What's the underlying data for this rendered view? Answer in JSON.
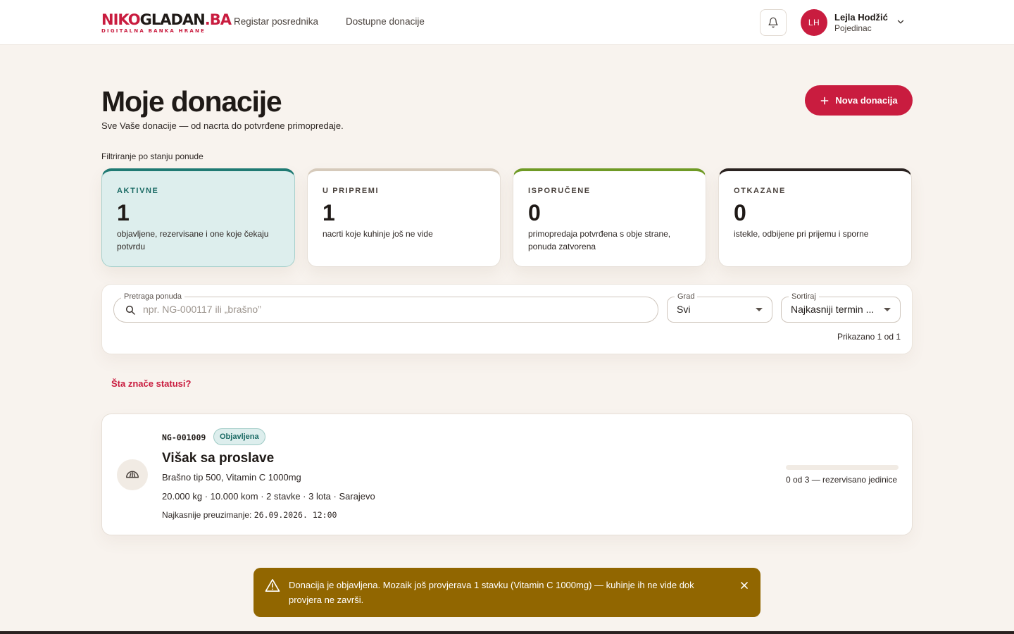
{
  "brand": {
    "logo_part1": "NIKO",
    "logo_part2": "GLADAN",
    "logo_part3": ".BA",
    "tagline": "DIGITALNA BANKA HRANE"
  },
  "nav": {
    "links": [
      "Registar posrednika",
      "Dostupne donacije"
    ]
  },
  "user": {
    "initials": "LH",
    "name": "Lejla Hodžić",
    "role": "Pojedinac"
  },
  "page": {
    "title": "Moje donacije",
    "subtitle": "Sve Vaše donacije — od nacrta do potvrđene primopredaje.",
    "new_button": "Nova donacija"
  },
  "filters": {
    "label": "Filtriranje po stanju ponude",
    "cards": [
      {
        "label": "AKTIVNE",
        "count": "1",
        "desc": "objavljene, rezervisane i one koje čekaju potvrdu",
        "accent": "#1f7a73",
        "selected": true
      },
      {
        "label": "U PRIPREMI",
        "count": "1",
        "desc": "nacrti koje kuhinje još ne vide",
        "accent": "#d6cabb",
        "selected": false
      },
      {
        "label": "ISPORUČENE",
        "count": "0",
        "desc": "primopredaja potvrđena s obje strane, ponuda zatvorena",
        "accent": "#6f9a25",
        "selected": false
      },
      {
        "label": "OTKAZANE",
        "count": "0",
        "desc": "istekle, odbijene pri prijemu i sporne",
        "accent": "#2a2220",
        "selected": false
      }
    ]
  },
  "search": {
    "label": "Pretraga ponuda",
    "placeholder": "npr. NG-000117 ili „brašno”",
    "value": "",
    "city_label": "Grad",
    "city_value": "Svi",
    "sort_label": "Sortiraj",
    "sort_value": "Najkasniji termin ...",
    "shown": "Prikazano 1 od 1"
  },
  "status_link": "Šta znače statusi?",
  "donations": [
    {
      "code": "NG-001009",
      "status": "Objavljena",
      "title": "Višak sa proslave",
      "items": "Brašno tip 500, Vitamin C 1000mg",
      "meta": "20.000 kg · 10.000 kom · 2 stavke · 3 lota · Sarajevo",
      "deadline_label": "Najkasnije preuzimanje:",
      "deadline_value": "26.09.2026. 12:00",
      "reserved": 0,
      "total": 3,
      "reserved_label": "0 od 3 — rezervisano jedinice",
      "icon": "bread-icon"
    }
  ],
  "toast": {
    "message": "Donacija je objavljena. Mozaik još provjerava 1 stavku (Vitamin C 1000mg) — kuhinje ih ne vide dok provjera ne završi.",
    "icon": "warning-icon",
    "color": "#916600"
  },
  "colors": {
    "brand": "#c91c3f",
    "active_accent": "#1f7a73",
    "background": "#f8f3ee"
  }
}
